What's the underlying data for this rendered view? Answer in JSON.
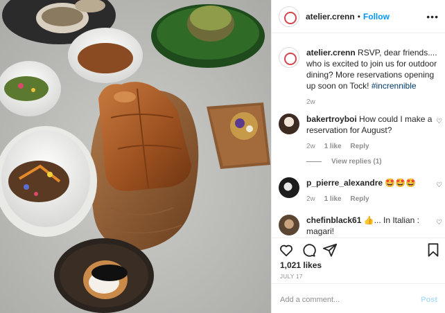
{
  "post": {
    "username": "atelier.crenn",
    "dot": "•",
    "follow_label": "Follow",
    "more_label": "•••"
  },
  "caption": {
    "username": "atelier.crenn",
    "text": " RSVP, dear friends.... who is excited to join us for outdoor dining? More reservations opening up soon on Tock! ",
    "hashtag": "#incrennible",
    "time": "2w"
  },
  "comments": [
    {
      "username": "bakertroyboi",
      "text": " How could I make a reservation for August?",
      "time": "2w",
      "likes": "1 like",
      "reply_label": "Reply",
      "view_replies": "View replies (1)"
    },
    {
      "username": "p_pierre_alexandre",
      "text": " 🤩🤩🤩",
      "time": "2w",
      "likes": "1 like",
      "reply_label": "Reply"
    },
    {
      "username": "chefinblack61",
      "text": " 👍... In Italian : magari!"
    }
  ],
  "actions": {
    "likes": "1,021 likes",
    "date": "JULY 17"
  },
  "add_comment": {
    "placeholder": "Add a comment...",
    "post_label": "Post"
  },
  "colors": {
    "accent": "#0095f6",
    "post_disabled": "#b2dffc",
    "muted": "#8e8e8e",
    "text": "#262626"
  },
  "icons": [
    "heart-icon",
    "comment-icon",
    "share-icon",
    "bookmark-icon",
    "more-icon"
  ]
}
